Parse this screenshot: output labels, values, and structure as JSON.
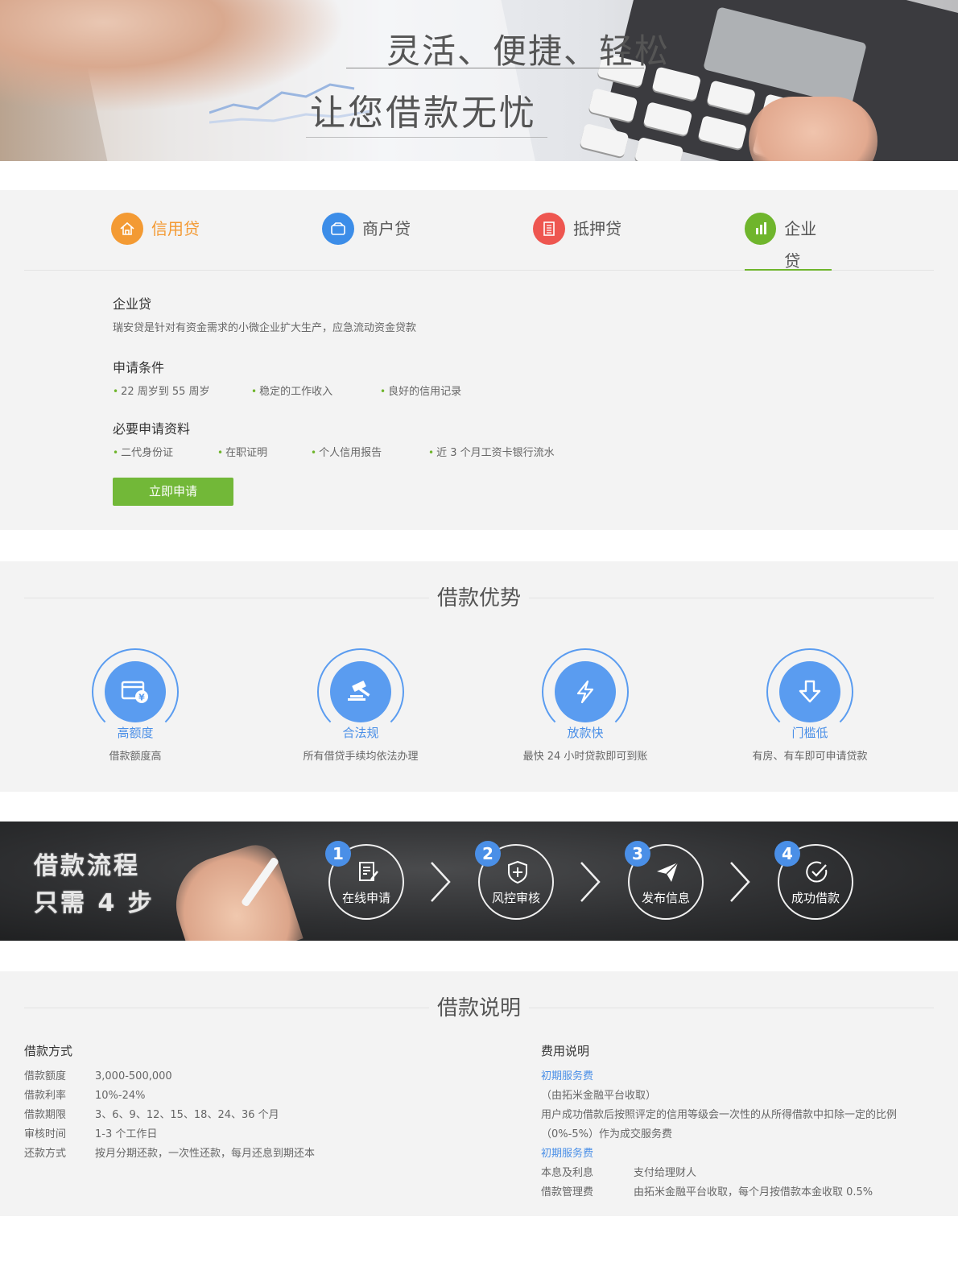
{
  "banner": {
    "slogan_line1": "灵活、便捷、轻松",
    "slogan_line2": "让您借款无忧"
  },
  "tabs": [
    {
      "label": "信用贷",
      "icon": "home-icon",
      "color": "#f39a33"
    },
    {
      "label": "商户贷",
      "icon": "wallet-icon",
      "color": "#3c8de8"
    },
    {
      "label": "抵押贷",
      "icon": "building-icon",
      "color": "#ee5650"
    },
    {
      "label": "企业贷",
      "icon": "bar-chart-icon",
      "color": "#6fb52c"
    }
  ],
  "product": {
    "name": "企业贷",
    "description": "瑞安贷是针对有资金需求的小微企业扩大生产，应急流动资金贷款",
    "conditions_title": "申请条件",
    "conditions": [
      "22 周岁到 55 周岁",
      "稳定的工作收入",
      "良好的信用记录"
    ],
    "materials_title": "必要申请资料",
    "materials": [
      "二代身份证",
      "在职证明",
      "个人信用报告",
      "近 3 个月工资卡银行流水"
    ],
    "apply_label": "立即申请"
  },
  "advantages": {
    "title": "借款优势",
    "items": [
      {
        "title": "高额度",
        "desc": "借款额度高",
        "icon": "card-yen-icon"
      },
      {
        "title": "合法规",
        "desc": "所有借贷手续均依法办理",
        "icon": "gavel-icon"
      },
      {
        "title": "放款快",
        "desc": "最快 24 小时贷款即可到账",
        "icon": "lightning-icon"
      },
      {
        "title": "门槛低",
        "desc": "有房、有车即可申请贷款",
        "icon": "down-arrow-icon"
      }
    ]
  },
  "process": {
    "title_line1": "借款流程",
    "title_line2": "只需 4 步",
    "steps": [
      {
        "num": "1",
        "label": "在线申请",
        "icon": "form-edit-icon"
      },
      {
        "num": "2",
        "label": "风控审核",
        "icon": "shield-plus-icon"
      },
      {
        "num": "3",
        "label": "发布信息",
        "icon": "paper-plane-icon"
      },
      {
        "num": "4",
        "label": "成功借款",
        "icon": "check-circle-icon"
      }
    ]
  },
  "explanation": {
    "title": "借款说明",
    "left_title": "借款方式",
    "left_rows": [
      {
        "k": "借款额度",
        "v": "3,000-500,000"
      },
      {
        "k": "借款利率",
        "v": "10%-24%"
      },
      {
        "k": "借款期限",
        "v": "3、6、9、12、15、18、24、36 个月"
      },
      {
        "k": "审核时间",
        "v": "1-3 个工作日"
      },
      {
        "k": "还款方式",
        "v": "按月分期还款，一次性还款，每月还息到期还本"
      }
    ],
    "right_title": "费用说明",
    "fee_link1": "初期服务费",
    "fee_note1": "（由拓米金融平台收取）",
    "fee_note2": "用户成功借款后按照评定的信用等级会一次性的从所得借款中扣除一定的比例",
    "fee_note3": "（0%-5%）作为成交服务费",
    "fee_link2": "初期服务费",
    "fee_rows": [
      {
        "k": "本息及利息",
        "v": "支付给理财人"
      },
      {
        "k": "借款管理费",
        "v": "由拓米金融平台收取，每个月按借款本金收取 0.5%"
      }
    ]
  }
}
